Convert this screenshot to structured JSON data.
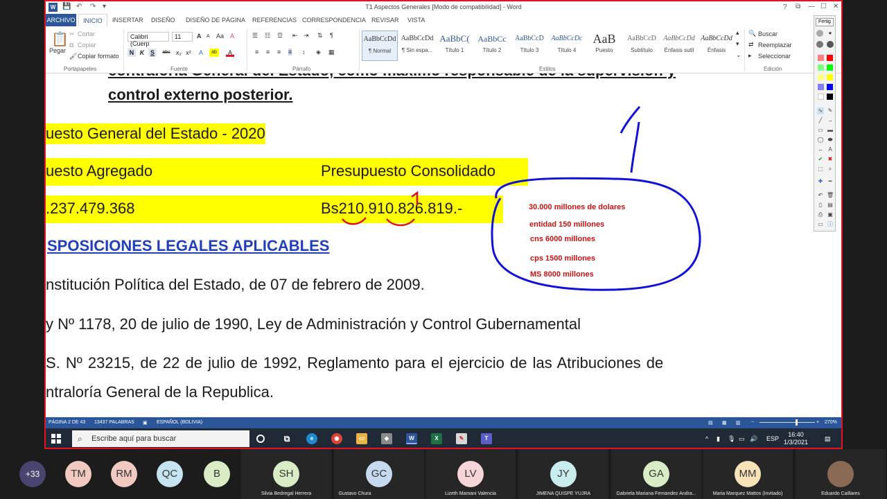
{
  "window": {
    "title": "T1 Aspectos Generales [Modo de compatibilidad] - Word",
    "word_badge": "W",
    "help_label": "?",
    "minimize_label": "—",
    "maximize_label": "☐",
    "close_label": "✕"
  },
  "ribbon_tabs": [
    "ARCHIVO",
    "INICIO",
    "INSERTAR",
    "DISEÑO",
    "DISEÑO DE PÁGINA",
    "REFERENCIAS",
    "CORRESPONDENCIA",
    "REVISAR",
    "VISTA"
  ],
  "clipboard": {
    "paste": "Pegar",
    "cut": "Cortar",
    "copy": "Copiar",
    "format_painter": "Copiar formato",
    "group": "Portapapeles"
  },
  "font": {
    "family": "Calibri (Cuerp",
    "size": "11",
    "grow": "A",
    "shrink": "A",
    "case": "Aa",
    "clear": "A",
    "bold": "N",
    "italic": "K",
    "underline": "S",
    "strike": "abc",
    "subscript": "x₂",
    "superscript": "x²",
    "text_effects": "A",
    "highlight": "ab",
    "font_color": "A",
    "group": "Fuente"
  },
  "paragraph": {
    "group": "Párrafo",
    "show_marks": "¶"
  },
  "styles": {
    "items": [
      {
        "preview": "AaBbCcDd",
        "label": "¶ Normal"
      },
      {
        "preview": "AaBbCcDd",
        "label": "¶ Sin espa..."
      },
      {
        "preview": "AaBbC(",
        "label": "Título 1"
      },
      {
        "preview": "AaBbCc",
        "label": "Título 2"
      },
      {
        "preview": "AaBbCcD",
        "label": "Título 3"
      },
      {
        "preview": "AaBbCcDc",
        "label": "Título 4"
      },
      {
        "preview": "AaB",
        "label": "Puesto"
      },
      {
        "preview": "AaBbCcD",
        "label": "Subtítulo"
      },
      {
        "preview": "AaBbCcDd",
        "label": "Énfasis sutil"
      },
      {
        "preview": "AaBbCcDd",
        "label": "Énfasis"
      }
    ],
    "group": "Estilos"
  },
  "editing": {
    "find": "Buscar",
    "replace": "Reemplazar",
    "select": "Seleccionar",
    "group": "Edición"
  },
  "document": {
    "line1": "contraloría General del Estado, como máximo responsable de la supervisión y",
    "line2": "control externo posterior.",
    "line3": "uesto General del Estado - 2020",
    "line4a": "uesto Agregado",
    "line4b": "Presupuesto Consolidado",
    "line5a": ".237.479.368",
    "line5b": "Bs210.910.826.819.-",
    "line6": "SPOSICIONES LEGALES APLICABLES",
    "line7": "nstitución Política del Estado, de 07 de febrero de 2009.",
    "line8": "y Nº 1178, 20 de julio de 1990, Ley de Administración y Control Gubernamental",
    "line9": "S.  Nº  23215,  de  22  de  julio  de  1992,  Reglamento  para  el  ejercicio  de  las  Atribuciones  de",
    "line10": "ntraloría General de la Republica."
  },
  "annotations": [
    "30.000 millones de dolares",
    "entidad 150 millones",
    "cns   6000 millones",
    "cps   1500 millones",
    "MS   8000 millones"
  ],
  "pen_palette": {
    "label": "Fertig",
    "colors": [
      "#ff8080",
      "#ff0000",
      "#80ff80",
      "#00ff00",
      "#ffff80",
      "#ffff00",
      "#8080ff",
      "#0000ff",
      "#ffffff",
      "#000000"
    ]
  },
  "status_bar": {
    "page": "PÁGINA 2 DE 43",
    "words": "13437 PALABRAS",
    "language": "ESPAÑOL (BOLIVIA)",
    "zoom": "270%"
  },
  "taskbar": {
    "search_placeholder": "Escribe aquí para buscar",
    "keyboard": "ESP",
    "time": "16:40",
    "date": "1/3/2021"
  },
  "participants": {
    "more": "+33",
    "items": [
      {
        "initials": "TM",
        "name": "",
        "color": "#f2c9c0"
      },
      {
        "initials": "RM",
        "name": "",
        "color": "#f2c9c0"
      },
      {
        "initials": "QC",
        "name": "",
        "color": "#c5e3f0"
      },
      {
        "initials": "B",
        "name": "",
        "color": "#d9ecc5"
      },
      {
        "initials": "SH",
        "name": "Silvia Bedregal Herrera",
        "color": "#d9ecc5"
      },
      {
        "initials": "GC",
        "name": "Gustavo Chura",
        "color": "#c5d9ef"
      },
      {
        "initials": "LV",
        "name": "Lizeth Mamani Valencia",
        "color": "#f6d5d8"
      },
      {
        "initials": "JY",
        "name": "JIMENA QUISPE YUJRA",
        "color": "#c9ecef"
      },
      {
        "initials": "GA",
        "name": "Gabriela Mariana Fernandez Andra...",
        "color": "#d9ecc5"
      },
      {
        "initials": "MM",
        "name": "Maria Marquez Mattos (Invitado)",
        "color": "#f8e2b8"
      },
      {
        "initials": "",
        "name": "Eduardo Caillares",
        "color": "#8a6a55"
      }
    ]
  }
}
